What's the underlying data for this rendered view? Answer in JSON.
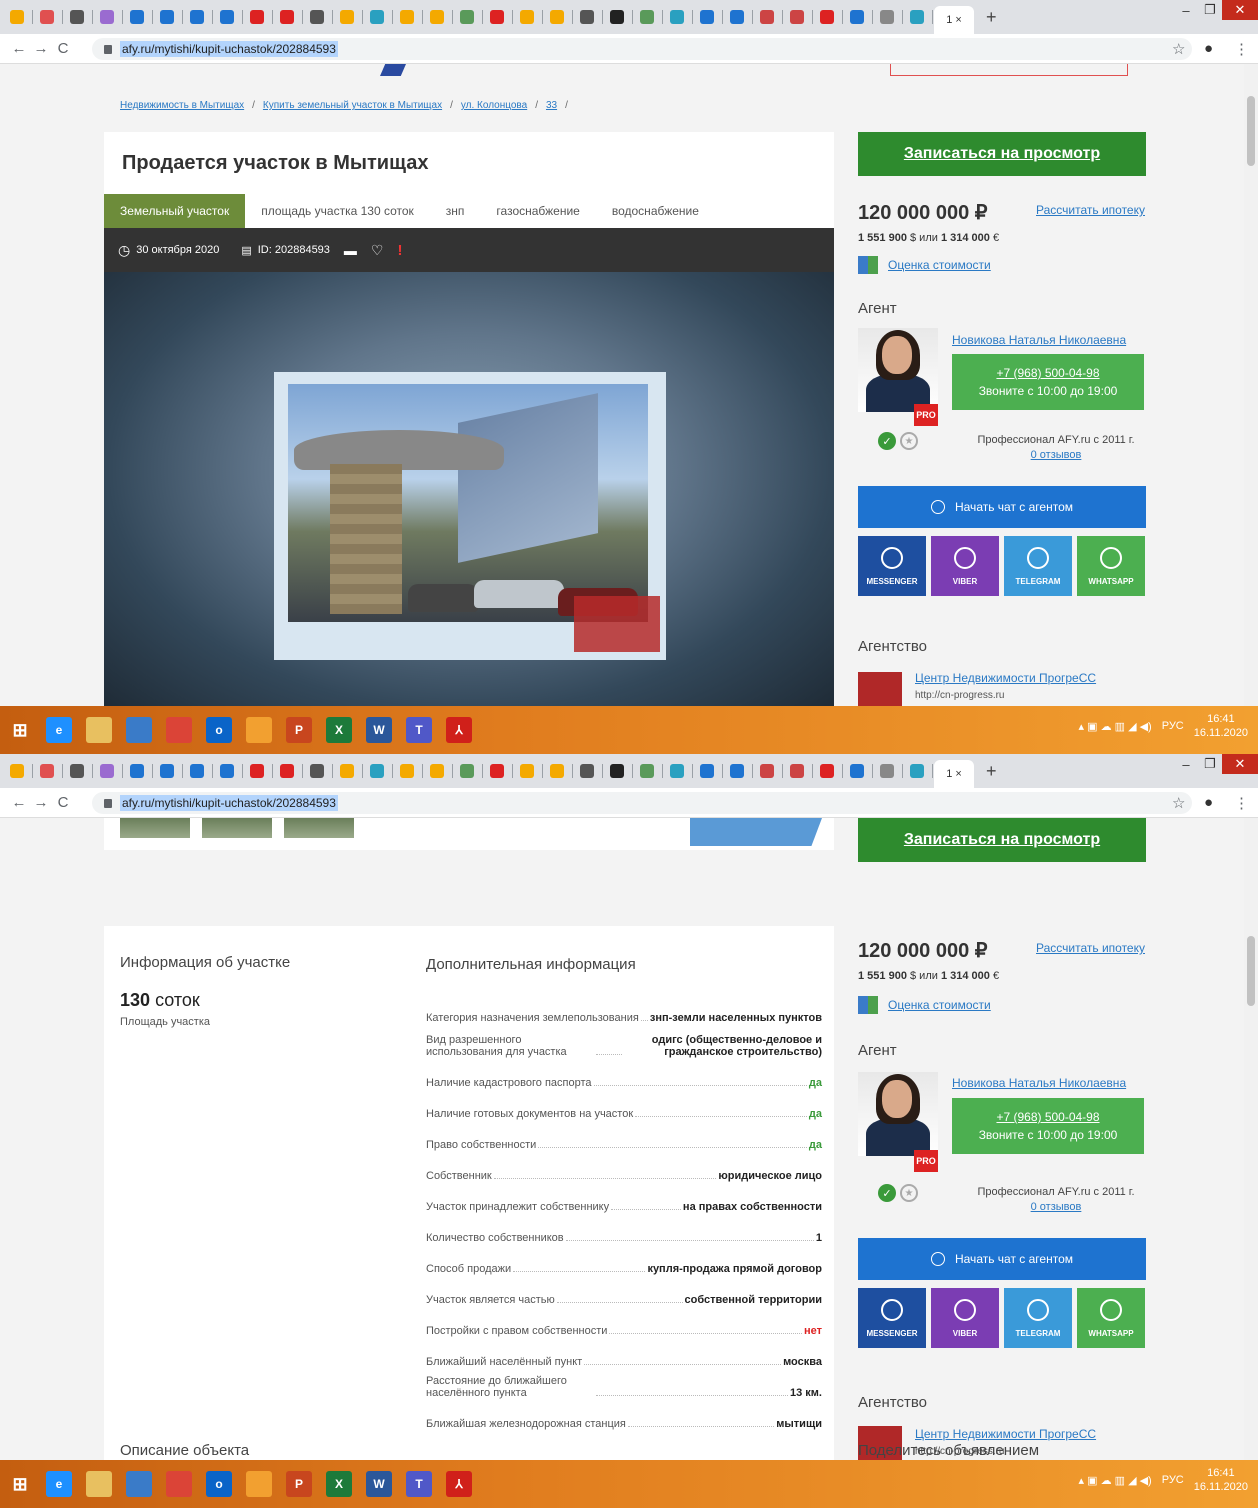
{
  "browser": {
    "tab_close_label": "1 ×",
    "url": "afy.ru/mytishi/kupit-uchastok/202884593",
    "tab_favicon_colors": [
      "#f4a900",
      "#e05050",
      "#555",
      "#9a6bd0",
      "#1e73d0",
      "#1e73d0",
      "#1e73d0",
      "#1e73d0",
      "#d22",
      "#d22",
      "#555",
      "#f4a900",
      "#2aa0c0",
      "#f4a900",
      "#f4a900",
      "#5a9a5a",
      "#d22",
      "#f4a900",
      "#f4a900",
      "#555",
      "#222",
      "#5a9a5a",
      "#2aa0c0",
      "#1e73d0",
      "#1e73d0",
      "#c44",
      "#c44",
      "#d22",
      "#1e73d0",
      "#888",
      "#2aa0c0"
    ]
  },
  "breadcrumbs": [
    "Недвижимость в Мытищах",
    "Купить земельный участок в Мытищах",
    "ул. Колонцова",
    "33"
  ],
  "listing": {
    "title": "Продается участок в Мытищах",
    "chips": [
      "Земельный участок",
      "площадь участка 130 соток",
      "знп",
      "газоснабжение",
      "водоснабжение"
    ],
    "date": "30 октября 2020",
    "id": "ID: 202884593",
    "exclaim": "!"
  },
  "sidebar": {
    "view_button": "Записаться на просмотр",
    "price": "120 000 000 ₽",
    "mortgage_link": "Рассчитать ипотеку",
    "usd": "1 551 900",
    "usd_sym": "$ или",
    "eur": "1 314 000",
    "eur_sym": "€",
    "estimate_link": "Оценка стоимости",
    "agent_heading": "Агент",
    "agent_name": "Новикова Наталья Николаевна",
    "pro_badge": "PRO",
    "phone": "+7 (968) 500-04-98",
    "call_hours": "Звоните с 10:00 до 19:00",
    "professional_since": "Профессионал AFY.ru с 2011 г.",
    "reviews": "0 отзывов",
    "chat_button": "Начать чат с агентом",
    "messengers": [
      {
        "label": "MESSENGER",
        "color": "#1e4fa0"
      },
      {
        "label": "VIBER",
        "color": "#7b3db3"
      },
      {
        "label": "TELEGRAM",
        "color": "#3a9ad9"
      },
      {
        "label": "WHATSAPP",
        "color": "#4caf50"
      }
    ],
    "agency_heading": "Агентство",
    "agency_name": "Центр Недвижимости ПрогреСС",
    "agency_url": "http://cn-progress.ru",
    "share_heading": "Поделитесь объявлением"
  },
  "info": {
    "left_heading": "Информация об участке",
    "area_number": "130",
    "area_unit": "соток",
    "area_label": "Площадь участка",
    "right_heading": "Дополнительная информация",
    "rows": [
      {
        "label": "Категория назначения землепользования",
        "value": "знп-земли населенных пунктов",
        "tone": ""
      },
      {
        "label": "Вид разрешенного использования для участка",
        "value": "одигс (общественно-деловое и гражданское строительство)",
        "tone": ""
      },
      {
        "label": "Наличие кадастрового паспорта",
        "value": "да",
        "tone": "g"
      },
      {
        "label": "Наличие готовых документов на участок",
        "value": "да",
        "tone": "g"
      },
      {
        "label": "Право собственности",
        "value": "да",
        "tone": "g"
      },
      {
        "label": "Собственник",
        "value": "юридическое лицо",
        "tone": ""
      },
      {
        "label": "Участок принадлежит собственнику",
        "value": "на правах собственности",
        "tone": ""
      },
      {
        "label": "Количество собственников",
        "value": "1",
        "tone": ""
      },
      {
        "label": "Способ продажи",
        "value": "купля-продажа прямой договор",
        "tone": ""
      },
      {
        "label": "Участок является частью",
        "value": "собственной территории",
        "tone": ""
      },
      {
        "label": "Постройки с правом собственности",
        "value": "нет",
        "tone": "r"
      },
      {
        "label": "Ближайший населённый пункт",
        "value": "москва",
        "tone": ""
      },
      {
        "label": "Расстояние до ближайшего населённого пункта",
        "value": "13 км.",
        "tone": ""
      },
      {
        "label": "Ближайшая железнодорожная станция",
        "value": "мытищи",
        "tone": ""
      }
    ]
  },
  "description_heading": "Описание объекта",
  "taskbar": {
    "lang": "РУС",
    "time": "16:41",
    "date": "16.11.2020",
    "apps": [
      {
        "name": "ie-icon",
        "color": "#1e90ff",
        "glyph": "e"
      },
      {
        "name": "explorer-icon",
        "color": "#e8c060",
        "glyph": ""
      },
      {
        "name": "notepad-icon",
        "color": "#3a7bc8",
        "glyph": ""
      },
      {
        "name": "chrome-icon",
        "color": "#db4437",
        "glyph": ""
      },
      {
        "name": "outlook-icon",
        "color": "#0a64c8",
        "glyph": "o"
      },
      {
        "name": "chart-app-icon",
        "color": "#f2a030",
        "glyph": ""
      },
      {
        "name": "powerpoint-icon",
        "color": "#c8461e",
        "glyph": "P"
      },
      {
        "name": "excel-icon",
        "color": "#1d7a3a",
        "glyph": "X"
      },
      {
        "name": "word-icon",
        "color": "#2b579a",
        "glyph": "W"
      },
      {
        "name": "teams-icon",
        "color": "#5058c8",
        "glyph": "T"
      },
      {
        "name": "acrobat-icon",
        "color": "#d0201a",
        "glyph": "⅄"
      }
    ]
  }
}
